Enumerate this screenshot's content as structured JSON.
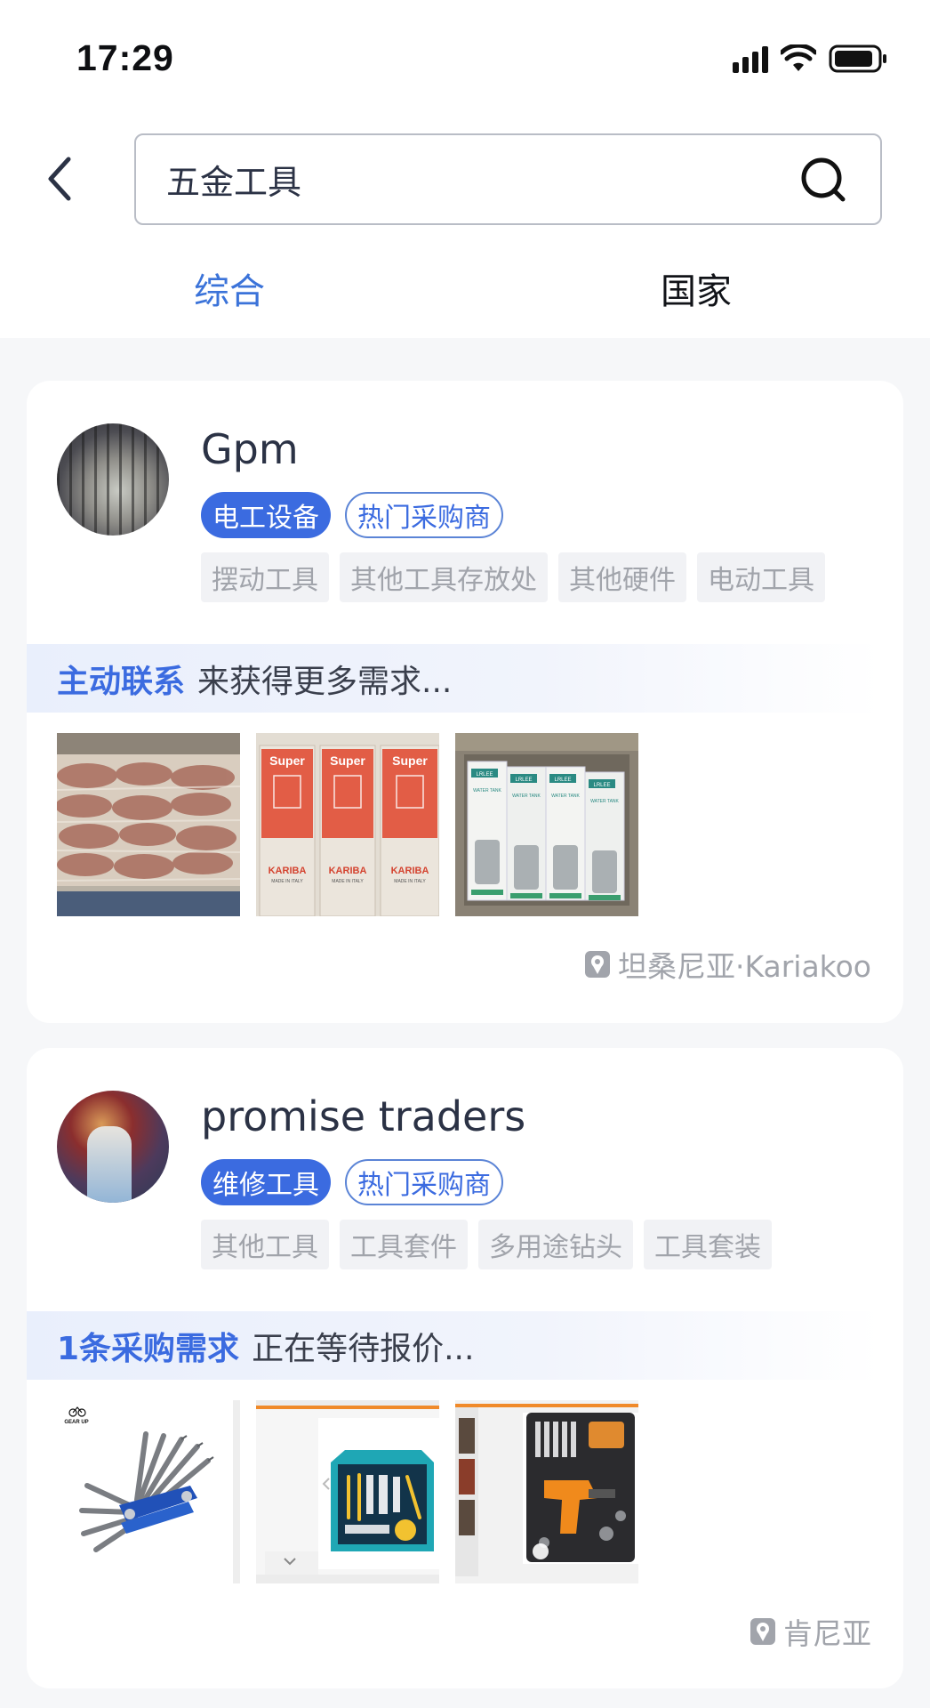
{
  "status_bar": {
    "time": "17:29"
  },
  "search": {
    "value": "五金工具"
  },
  "tabs": [
    {
      "label": "综合",
      "active": true
    },
    {
      "label": "国家",
      "active": false
    }
  ],
  "colors": {
    "accent": "#3b6be0",
    "tab_active": "#3b73d9",
    "tag_gray_bg": "#f1f2f5",
    "muted": "#a1a4ab"
  },
  "results": [
    {
      "name": "Gpm",
      "primary_tag": "电工设备",
      "outline_tag": "热门采购商",
      "tags": [
        "摆动工具",
        "其他工具存放处",
        "其他硬件",
        "电动工具"
      ],
      "promo_highlight": "主动联系",
      "promo_text": "来获得更多需求...",
      "thumbs": [
        {
          "labels": []
        },
        {
          "labels": [
            "Super",
            "Super",
            "Super",
            "KARIBA",
            "KARIBA",
            "KARIBA",
            "MADE IN ITALY",
            "MADE IN ITALY",
            "MADE IN ITALY"
          ]
        },
        {
          "labels": [
            "LRLEE",
            "LRLEE",
            "LRLEE",
            "LRLEE",
            "WATER TANK",
            "WATER TANK",
            "WATER TANK",
            "WATER TANK"
          ]
        }
      ],
      "location": "坦桑尼亚·Kariakoo"
    },
    {
      "name": "promise traders",
      "primary_tag": "维修工具",
      "outline_tag": "热门采购商",
      "tags": [
        "其他工具",
        "工具套件",
        "多用途钻头",
        "工具套装"
      ],
      "promo_highlight": "1条采购需求",
      "promo_text": "正在等待报价...",
      "thumbs": [
        {
          "labels": [
            "GEAR UP"
          ]
        },
        {
          "labels": []
        },
        {
          "labels": []
        }
      ],
      "location": "肯尼亚"
    }
  ],
  "icons": {
    "back": "chevron-left-icon",
    "search": "search-icon",
    "location": "location-pin-icon",
    "signal": "signal-icon",
    "wifi": "wifi-icon",
    "battery": "battery-icon"
  }
}
